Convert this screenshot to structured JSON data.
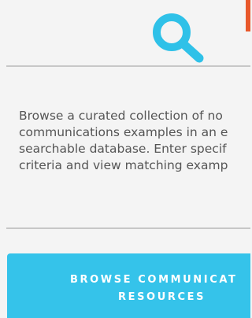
{
  "colors": {
    "accent": "#e8582a",
    "icon": "#2fc1e8",
    "button": "#35c3ea",
    "text": "#555555"
  },
  "header": {
    "icon": "search-icon"
  },
  "description": {
    "lines": [
      "Browse a curated collection of no",
      "communications examples in an e",
      "searchable database. Enter specif",
      "criteria and view matching examp"
    ]
  },
  "cta": {
    "lines": [
      "BROWSE COMMUNICAT",
      "RESOURCES"
    ]
  }
}
